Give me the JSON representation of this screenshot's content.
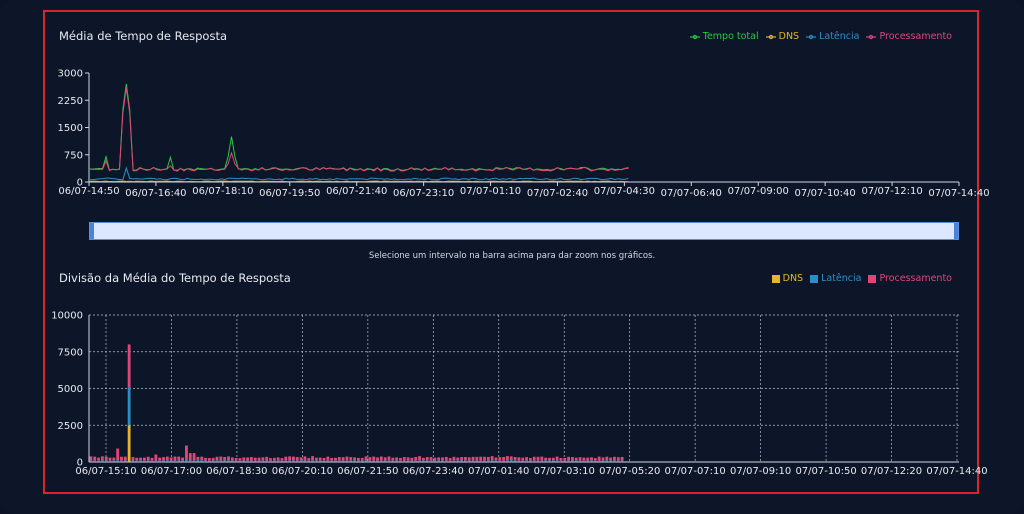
{
  "chart_data": [
    {
      "type": "line",
      "title": "Média de Tempo de Resposta",
      "series": [
        {
          "name": "Tempo total",
          "color": "#27c93f"
        },
        {
          "name": "DNS",
          "color": "#e6b432"
        },
        {
          "name": "Latência",
          "color": "#2b8fc7"
        },
        {
          "name": "Processamento",
          "color": "#e0457b"
        }
      ],
      "ylim": [
        0,
        3000
      ],
      "y_ticks": [
        "3000",
        "2250",
        "1500",
        "750",
        "0"
      ],
      "x_ticks_row1": [
        "06/07-14:50",
        "06/07-18:10",
        "06/07-21:40",
        "07/07-01:10",
        "07/07-04:30",
        "07/07-09:00",
        "07/07-12:10"
      ],
      "x_ticks_row2": [
        "06/07-16:40",
        "06/07-19:50",
        "06/07-23:10",
        "07/07-02:40",
        "07/07-06:40",
        "07/07-10:40",
        "07/07-14:40"
      ],
      "x_ticks_all": [
        "06/07-14:50",
        "06/07-16:40",
        "06/07-18:10",
        "06/07-19:50",
        "06/07-21:40",
        "06/07-23:10",
        "07/07-01:10",
        "07/07-02:40",
        "07/07-04:30",
        "07/07-06:40",
        "07/07-09:00",
        "07/07-10:40",
        "07/07-12:10",
        "07/07-14:40"
      ],
      "data_extent_fraction": 0.62,
      "grid": false,
      "legend": "top-right"
    },
    {
      "type": "bar",
      "title": "Divisão da Média do Tempo de Resposta",
      "series": [
        {
          "name": "DNS",
          "color": "#e6b432"
        },
        {
          "name": "Latência",
          "color": "#2b8fc7"
        },
        {
          "name": "Processamento",
          "color": "#e0457b"
        }
      ],
      "ylim": [
        0,
        10000
      ],
      "y_ticks": [
        "10000",
        "7500",
        "5000",
        "2500",
        "0"
      ],
      "x_ticks": [
        "06/07-15:10",
        "06/07-17:00",
        "06/07-18:30",
        "06/07-20:10",
        "06/07-21:50",
        "06/07-23:40",
        "07/07-01:40",
        "07/07-03:10",
        "07/07-05:20",
        "07/07-07:10",
        "07/07-09:10",
        "07/07-10:50",
        "07/07-12:20",
        "07/07-14:40"
      ],
      "spike": {
        "dns": 2500,
        "latencia": 2600,
        "processamento": 2900
      },
      "grid": true,
      "legend": "top-right"
    }
  ],
  "hint": "Selecione um intervalo na barra acima para dar zoom nos gráficos."
}
